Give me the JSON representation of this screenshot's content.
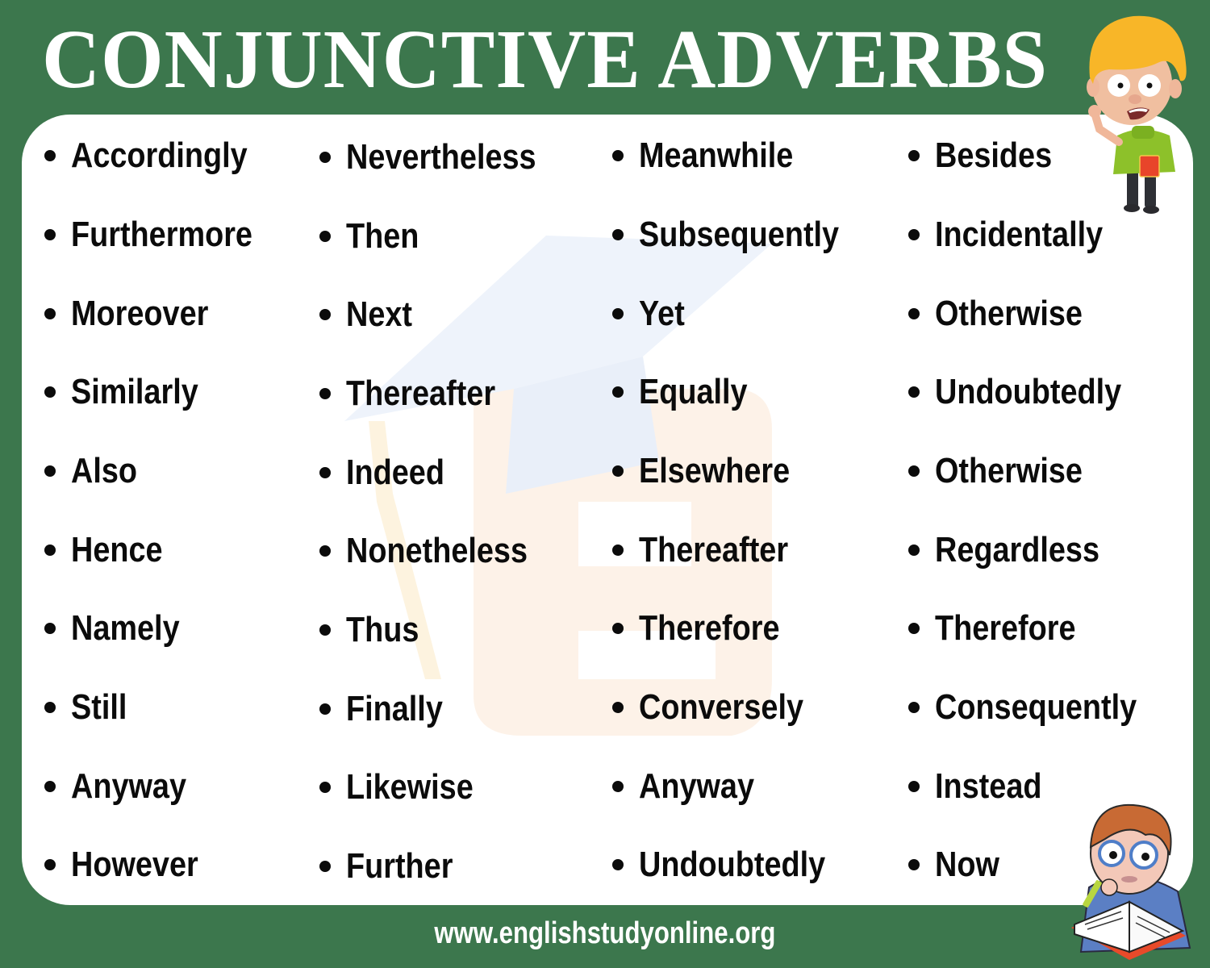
{
  "header": {
    "title": "CONJUNCTIVE ADVERBS"
  },
  "columns": [
    {
      "items": [
        "Accordingly",
        "Furthermore",
        "Moreover",
        "Similarly",
        "Also",
        "Hence",
        "Namely",
        "Still",
        "Anyway",
        "However"
      ]
    },
    {
      "items": [
        "Nevertheless",
        "Then",
        "Next",
        "Thereafter",
        "Indeed",
        "Nonetheless",
        "Thus",
        "Finally",
        "Likewise",
        "Further"
      ]
    },
    {
      "items": [
        "Meanwhile",
        "Subsequently",
        "Yet",
        "Equally",
        "Elsewhere",
        "Thereafter",
        "Therefore",
        "Conversely",
        "Anyway",
        "Undoubtedly"
      ]
    },
    {
      "items": [
        "Besides",
        "Incidentally",
        "Otherwise",
        "Undoubtedly",
        "Otherwise",
        "Regardless",
        "Therefore",
        "Consequently",
        "Instead",
        "Now"
      ]
    }
  ],
  "footer": {
    "url": "www.englishstudyonline.org"
  },
  "colors": {
    "background": "#3c774d",
    "card": "#ffffff",
    "text": "#0b0b0b",
    "title": "#ffffff"
  },
  "illustrations": {
    "top_right": "cartoon-boy-holding-book",
    "bottom_right": "cartoon-student-thinking-with-book",
    "watermark": "graduation-cap-letter-e-logo"
  }
}
